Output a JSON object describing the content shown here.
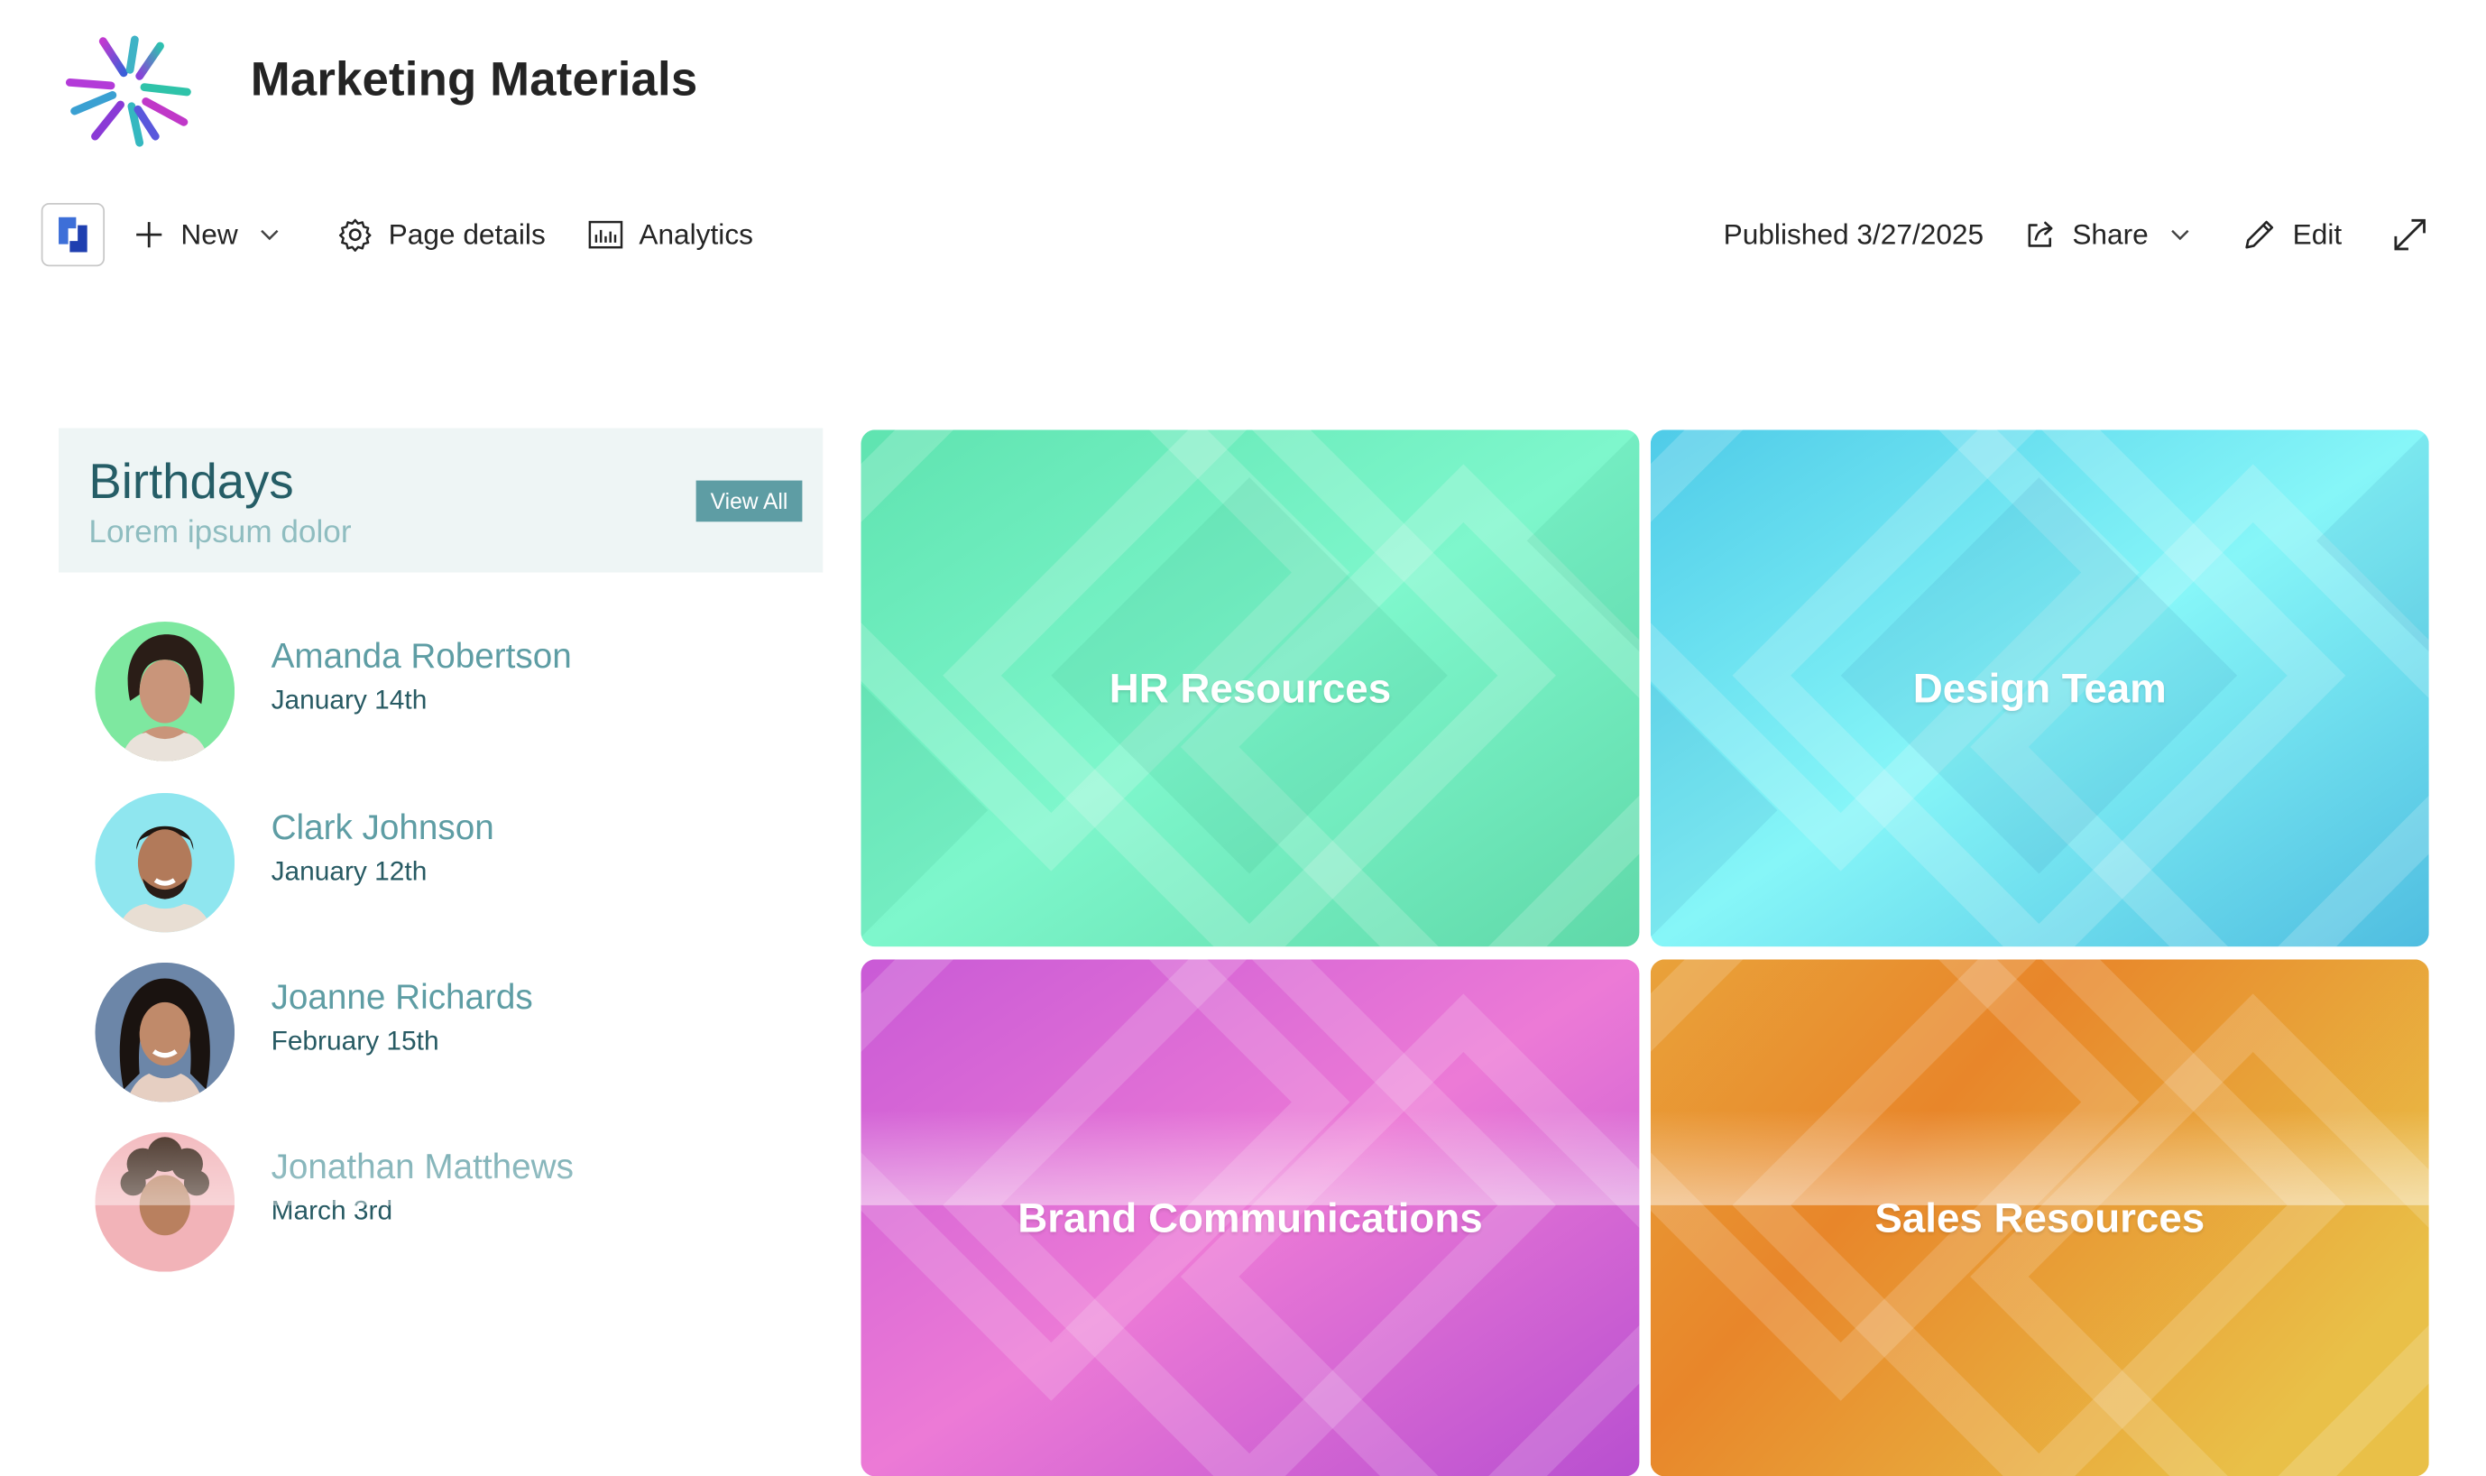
{
  "site": {
    "title": "Marketing Materials",
    "logo_icon": "starburst-logo"
  },
  "commandbar": {
    "new_label": "New",
    "page_details_label": "Page details",
    "analytics_label": "Analytics",
    "published_label": "Published 3/27/2025",
    "share_label": "Share",
    "edit_label": "Edit"
  },
  "birthdays": {
    "title": "Birthdays",
    "subtitle": "Lorem ipsum dolor",
    "view_all_label": "View All",
    "people": [
      {
        "name": "Amanda Robertson",
        "date": "January 14th",
        "avatar_bg": "#7ee8a0"
      },
      {
        "name": "Clark Johnson",
        "date": "January 12th",
        "avatar_bg": "#8fe6ef"
      },
      {
        "name": "Joanne Richards",
        "date": "February 15th",
        "avatar_bg": "#6c86a8"
      },
      {
        "name": "Jonathan Matthews",
        "date": "March 3rd",
        "avatar_bg": "#f2b3b8"
      }
    ]
  },
  "tiles": [
    {
      "label": "HR Resources",
      "color_a": "#5fe3b0",
      "color_b": "#7ef7cc"
    },
    {
      "label": "Design Team",
      "color_a": "#4fcbe8",
      "color_b": "#86f6f8"
    },
    {
      "label": "Brand Communications",
      "color_a": "#c95ad6",
      "color_b": "#ec7ad6"
    },
    {
      "label": "Sales Resources",
      "color_a": "#e88a26",
      "color_b": "#e9c048"
    }
  ]
}
